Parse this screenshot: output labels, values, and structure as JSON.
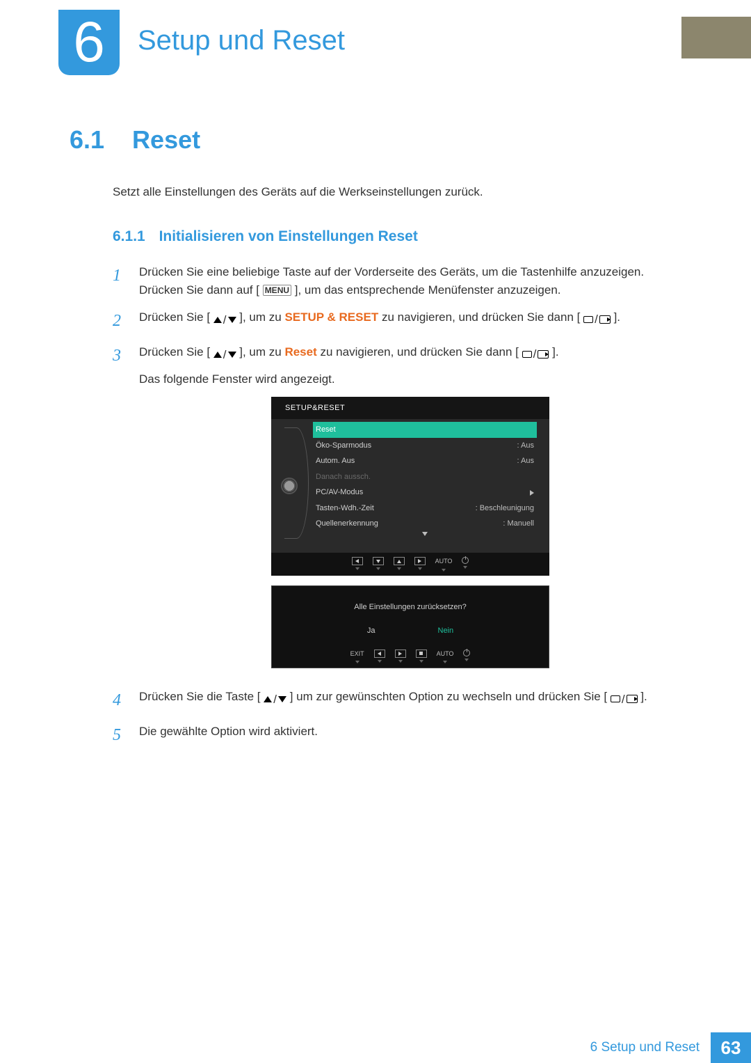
{
  "chapter": {
    "number": "6",
    "title": "Setup und Reset"
  },
  "section": {
    "number": "6.1",
    "title": "Reset",
    "intro": "Setzt alle Einstellungen des Geräts auf die Werkseinstellungen zurück."
  },
  "subsection": {
    "number": "6.1.1",
    "title": "Initialisieren von Einstellungen Reset"
  },
  "steps": {
    "s1": {
      "line1": "Drücken Sie eine beliebige Taste auf der Vorderseite des Geräts, um die Tastenhilfe anzuzeigen.",
      "line2a": "Drücken Sie dann auf [",
      "menu": "MENU",
      "line2b": "], um das entsprechende Menüfenster anzuzeigen."
    },
    "s2": {
      "a": "Drücken Sie [",
      "b": "], um zu ",
      "hl": "SETUP & RESET",
      "c": " zu navigieren, und drücken Sie dann [",
      "d": "]."
    },
    "s3": {
      "a": "Drücken Sie [",
      "b": "], um zu ",
      "hl": "Reset",
      "c": " zu navigieren, und drücken Sie dann [",
      "d": "].",
      "follow": "Das folgende Fenster wird angezeigt."
    },
    "s4": {
      "a": "Drücken Sie die Taste [",
      "b": "] um zur gewünschten Option zu wechseln und drücken Sie [",
      "c": "]."
    },
    "s5": "Die gewählte Option wird aktiviert."
  },
  "osd1": {
    "header": "SETUP&RESET",
    "rows": {
      "reset": "Reset",
      "eco": "Öko-Sparmodus",
      "eco_v": "Aus",
      "auto": "Autom. Aus",
      "auto_v": "Aus",
      "after": "Danach aussch.",
      "pcav": "PC/AV-Modus",
      "key": "Tasten-Wdh.-Zeit",
      "key_v": "Beschleunigung",
      "src": "Quellenerkennung",
      "src_v": "Manuell"
    },
    "footer_auto": "AUTO"
  },
  "osd2": {
    "question": "Alle Einstellungen zurücksetzen?",
    "yes": "Ja",
    "no": "Nein",
    "exit": "EXIT",
    "auto": "AUTO"
  },
  "footer": {
    "text": "6 Setup und Reset",
    "page": "63"
  }
}
